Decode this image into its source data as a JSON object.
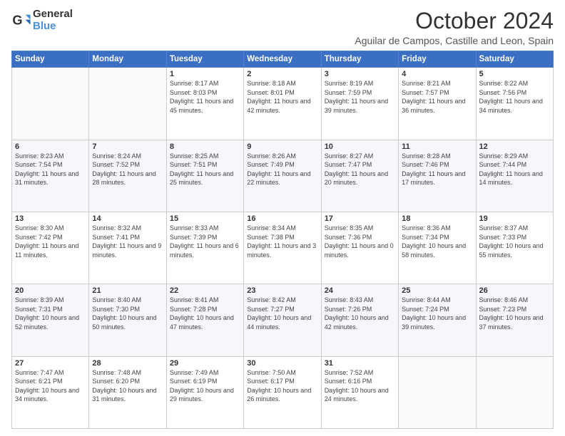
{
  "logo": {
    "general": "General",
    "blue": "Blue"
  },
  "title": "October 2024",
  "subtitle": "Aguilar de Campos, Castille and Leon, Spain",
  "days_of_week": [
    "Sunday",
    "Monday",
    "Tuesday",
    "Wednesday",
    "Thursday",
    "Friday",
    "Saturday"
  ],
  "weeks": [
    [
      {
        "day": "",
        "info": ""
      },
      {
        "day": "",
        "info": ""
      },
      {
        "day": "1",
        "sunrise": "Sunrise: 8:17 AM",
        "sunset": "Sunset: 8:03 PM",
        "daylight": "Daylight: 11 hours and 45 minutes."
      },
      {
        "day": "2",
        "sunrise": "Sunrise: 8:18 AM",
        "sunset": "Sunset: 8:01 PM",
        "daylight": "Daylight: 11 hours and 42 minutes."
      },
      {
        "day": "3",
        "sunrise": "Sunrise: 8:19 AM",
        "sunset": "Sunset: 7:59 PM",
        "daylight": "Daylight: 11 hours and 39 minutes."
      },
      {
        "day": "4",
        "sunrise": "Sunrise: 8:21 AM",
        "sunset": "Sunset: 7:57 PM",
        "daylight": "Daylight: 11 hours and 36 minutes."
      },
      {
        "day": "5",
        "sunrise": "Sunrise: 8:22 AM",
        "sunset": "Sunset: 7:56 PM",
        "daylight": "Daylight: 11 hours and 34 minutes."
      }
    ],
    [
      {
        "day": "6",
        "sunrise": "Sunrise: 8:23 AM",
        "sunset": "Sunset: 7:54 PM",
        "daylight": "Daylight: 11 hours and 31 minutes."
      },
      {
        "day": "7",
        "sunrise": "Sunrise: 8:24 AM",
        "sunset": "Sunset: 7:52 PM",
        "daylight": "Daylight: 11 hours and 28 minutes."
      },
      {
        "day": "8",
        "sunrise": "Sunrise: 8:25 AM",
        "sunset": "Sunset: 7:51 PM",
        "daylight": "Daylight: 11 hours and 25 minutes."
      },
      {
        "day": "9",
        "sunrise": "Sunrise: 8:26 AM",
        "sunset": "Sunset: 7:49 PM",
        "daylight": "Daylight: 11 hours and 22 minutes."
      },
      {
        "day": "10",
        "sunrise": "Sunrise: 8:27 AM",
        "sunset": "Sunset: 7:47 PM",
        "daylight": "Daylight: 11 hours and 20 minutes."
      },
      {
        "day": "11",
        "sunrise": "Sunrise: 8:28 AM",
        "sunset": "Sunset: 7:46 PM",
        "daylight": "Daylight: 11 hours and 17 minutes."
      },
      {
        "day": "12",
        "sunrise": "Sunrise: 8:29 AM",
        "sunset": "Sunset: 7:44 PM",
        "daylight": "Daylight: 11 hours and 14 minutes."
      }
    ],
    [
      {
        "day": "13",
        "sunrise": "Sunrise: 8:30 AM",
        "sunset": "Sunset: 7:42 PM",
        "daylight": "Daylight: 11 hours and 11 minutes."
      },
      {
        "day": "14",
        "sunrise": "Sunrise: 8:32 AM",
        "sunset": "Sunset: 7:41 PM",
        "daylight": "Daylight: 11 hours and 9 minutes."
      },
      {
        "day": "15",
        "sunrise": "Sunrise: 8:33 AM",
        "sunset": "Sunset: 7:39 PM",
        "daylight": "Daylight: 11 hours and 6 minutes."
      },
      {
        "day": "16",
        "sunrise": "Sunrise: 8:34 AM",
        "sunset": "Sunset: 7:38 PM",
        "daylight": "Daylight: 11 hours and 3 minutes."
      },
      {
        "day": "17",
        "sunrise": "Sunrise: 8:35 AM",
        "sunset": "Sunset: 7:36 PM",
        "daylight": "Daylight: 11 hours and 0 minutes."
      },
      {
        "day": "18",
        "sunrise": "Sunrise: 8:36 AM",
        "sunset": "Sunset: 7:34 PM",
        "daylight": "Daylight: 10 hours and 58 minutes."
      },
      {
        "day": "19",
        "sunrise": "Sunrise: 8:37 AM",
        "sunset": "Sunset: 7:33 PM",
        "daylight": "Daylight: 10 hours and 55 minutes."
      }
    ],
    [
      {
        "day": "20",
        "sunrise": "Sunrise: 8:39 AM",
        "sunset": "Sunset: 7:31 PM",
        "daylight": "Daylight: 10 hours and 52 minutes."
      },
      {
        "day": "21",
        "sunrise": "Sunrise: 8:40 AM",
        "sunset": "Sunset: 7:30 PM",
        "daylight": "Daylight: 10 hours and 50 minutes."
      },
      {
        "day": "22",
        "sunrise": "Sunrise: 8:41 AM",
        "sunset": "Sunset: 7:28 PM",
        "daylight": "Daylight: 10 hours and 47 minutes."
      },
      {
        "day": "23",
        "sunrise": "Sunrise: 8:42 AM",
        "sunset": "Sunset: 7:27 PM",
        "daylight": "Daylight: 10 hours and 44 minutes."
      },
      {
        "day": "24",
        "sunrise": "Sunrise: 8:43 AM",
        "sunset": "Sunset: 7:26 PM",
        "daylight": "Daylight: 10 hours and 42 minutes."
      },
      {
        "day": "25",
        "sunrise": "Sunrise: 8:44 AM",
        "sunset": "Sunset: 7:24 PM",
        "daylight": "Daylight: 10 hours and 39 minutes."
      },
      {
        "day": "26",
        "sunrise": "Sunrise: 8:46 AM",
        "sunset": "Sunset: 7:23 PM",
        "daylight": "Daylight: 10 hours and 37 minutes."
      }
    ],
    [
      {
        "day": "27",
        "sunrise": "Sunrise: 7:47 AM",
        "sunset": "Sunset: 6:21 PM",
        "daylight": "Daylight: 10 hours and 34 minutes."
      },
      {
        "day": "28",
        "sunrise": "Sunrise: 7:48 AM",
        "sunset": "Sunset: 6:20 PM",
        "daylight": "Daylight: 10 hours and 31 minutes."
      },
      {
        "day": "29",
        "sunrise": "Sunrise: 7:49 AM",
        "sunset": "Sunset: 6:19 PM",
        "daylight": "Daylight: 10 hours and 29 minutes."
      },
      {
        "day": "30",
        "sunrise": "Sunrise: 7:50 AM",
        "sunset": "Sunset: 6:17 PM",
        "daylight": "Daylight: 10 hours and 26 minutes."
      },
      {
        "day": "31",
        "sunrise": "Sunrise: 7:52 AM",
        "sunset": "Sunset: 6:16 PM",
        "daylight": "Daylight: 10 hours and 24 minutes."
      },
      {
        "day": "",
        "info": ""
      },
      {
        "day": "",
        "info": ""
      }
    ]
  ]
}
